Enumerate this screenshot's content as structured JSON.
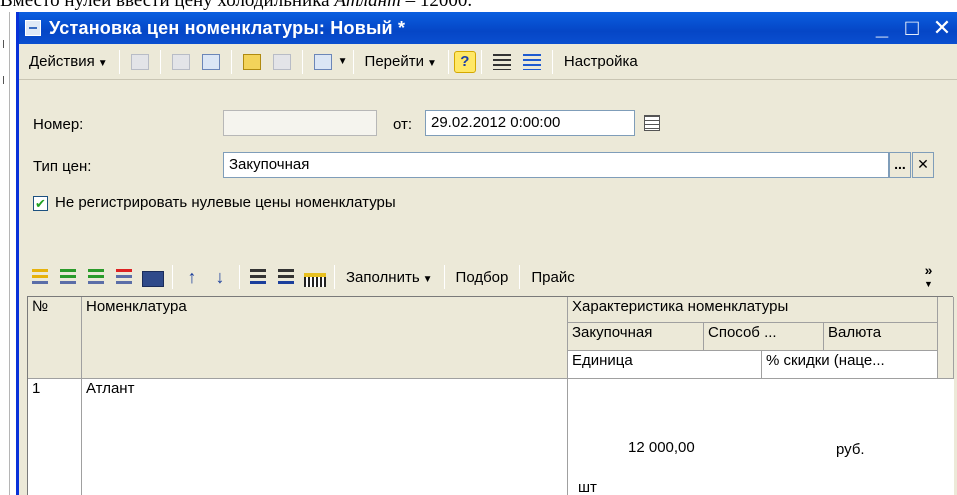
{
  "doc_caption": {
    "prefix": "Вместо нулей ввести цену холодильника ",
    "italic": "Атлант",
    "suffix": " – 12000."
  },
  "window": {
    "title": "Установка цен номенклатуры: Новый *",
    "btn_min": "_",
    "btn_max": "□",
    "btn_close": "✕"
  },
  "toolbar": {
    "actions": "Действия",
    "goto": "Перейти",
    "help": "?",
    "settings": "Настройка"
  },
  "form": {
    "number_label": "Номер:",
    "number_value": "",
    "date_label": "от:",
    "date_value": "29.02.2012  0:00:00",
    "price_type_label": "Тип цен:",
    "price_type_value": "Закупочная",
    "select_btn": "...",
    "clear_btn": "✕",
    "checkbox_checked": true,
    "checkbox_mark": "✔",
    "checkbox_label": "Не регистрировать нулевые цены номенклатуры"
  },
  "grid_toolbar": {
    "fill": "Заполнить",
    "pick": "Подбор",
    "price": "Прайс",
    "more": "»"
  },
  "table": {
    "headers": {
      "num": "№",
      "item": "Номенклатура",
      "characteristic": "Характеристика номенклатуры",
      "purchase": "Закупочная",
      "method": "Способ ...",
      "currency": "Валюта",
      "unit": "Единица",
      "discount": "% скидки (наце..."
    },
    "rows": [
      {
        "num": "1",
        "item": "Атлант",
        "price": "12 000,00",
        "currency": "руб.",
        "unit": "шт"
      }
    ]
  }
}
